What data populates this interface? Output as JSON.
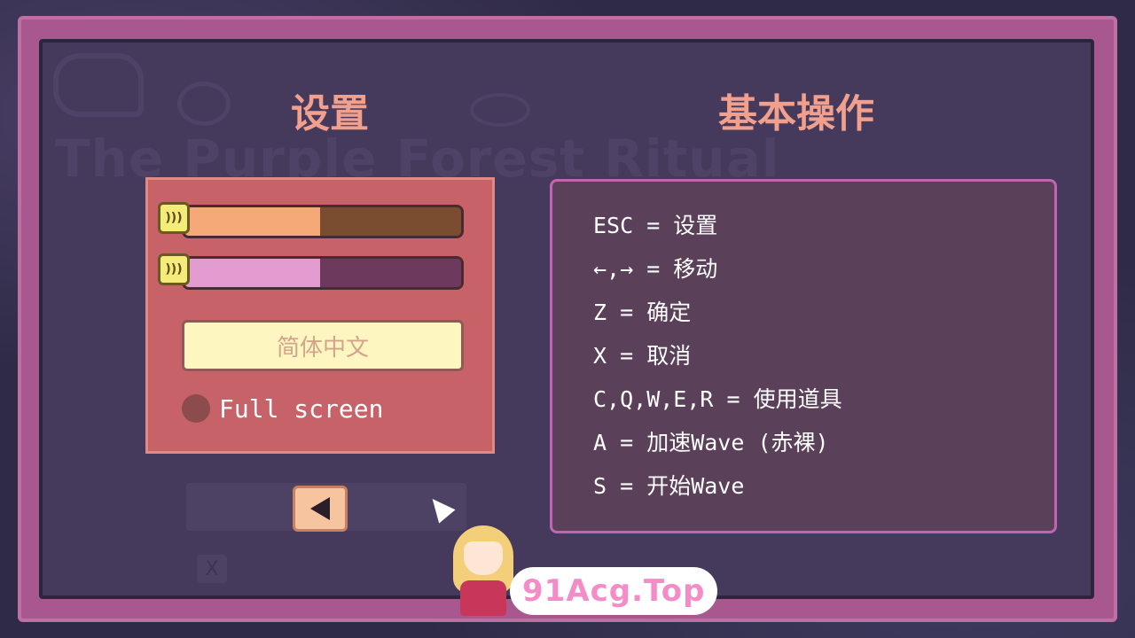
{
  "game": {
    "background_title": "The Purple Forest Ritual"
  },
  "settings": {
    "heading": "设置",
    "sliders": [
      {
        "name": "volume-1",
        "level": 0.49,
        "icon": "sound-icon"
      },
      {
        "name": "volume-2",
        "level": 0.49,
        "icon": "sound-icon"
      }
    ],
    "language_button": "简体中文",
    "fullscreen_label": "Full screen",
    "fullscreen_checked": false
  },
  "controls": {
    "heading": "基本操作",
    "lines": [
      "ESC = 设置",
      "←,→ = 移动",
      "Z = 确定",
      "X = 取消",
      "C,Q,W,E,R = 使用道具",
      "A = 加速Wave (赤裸)",
      "S = 开始Wave"
    ]
  },
  "nav": {
    "back_icon": "back-arrow-icon",
    "close_icon": "x-icon",
    "close_label": "X"
  },
  "watermark": {
    "text": "91Acg.Top"
  },
  "colors": {
    "frame": "#a8588e",
    "inner": "#453a5c",
    "heading": "#f2a08e",
    "settings_panel": "#c66268",
    "controls_panel": "#5a4058",
    "controls_border": "#c165b3"
  }
}
